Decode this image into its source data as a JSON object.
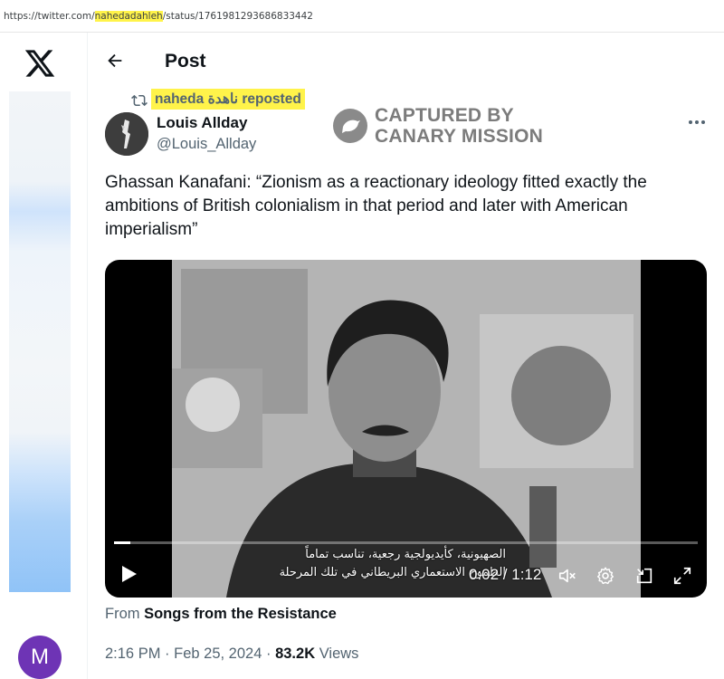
{
  "browser": {
    "url_prefix": "https://twitter.com/",
    "url_user": "nahedadahleh",
    "url_suffix": "/status/1761981293686833442"
  },
  "header": {
    "title": "Post"
  },
  "repost": {
    "label": "naheda ناهدة reposted"
  },
  "author": {
    "name": "Louis Allday",
    "handle": "@Louis_Allday"
  },
  "watermark": {
    "line1": "CAPTURED BY",
    "line2": "CANARY MISSION"
  },
  "tweet": {
    "text": "Ghassan Kanafani: “Zionism as a reactionary ideology fitted exactly the ambitions of British colonialism in that period and later with American imperialism”"
  },
  "video": {
    "subtitle_line1": "الصهيونية، كأيديولجية رجعية، تناسب تماماً",
    "subtitle_line2": "الطموح الاستعماري البريطاني في تلك المرحلة",
    "time": "0:02 / 1:12",
    "progress": 0.028
  },
  "source": {
    "prefix": "From",
    "name": "Songs from the Resistance"
  },
  "meta": {
    "time": "2:16 PM",
    "sep": "·",
    "date": "Feb 25, 2024",
    "views": "83.2K",
    "views_label": "Views"
  },
  "sidebar": {
    "avatar_letter": "M"
  },
  "colors": {
    "highlight": "#fff34a",
    "avatar": "#6e34b5",
    "secondary_text": "#536471"
  }
}
